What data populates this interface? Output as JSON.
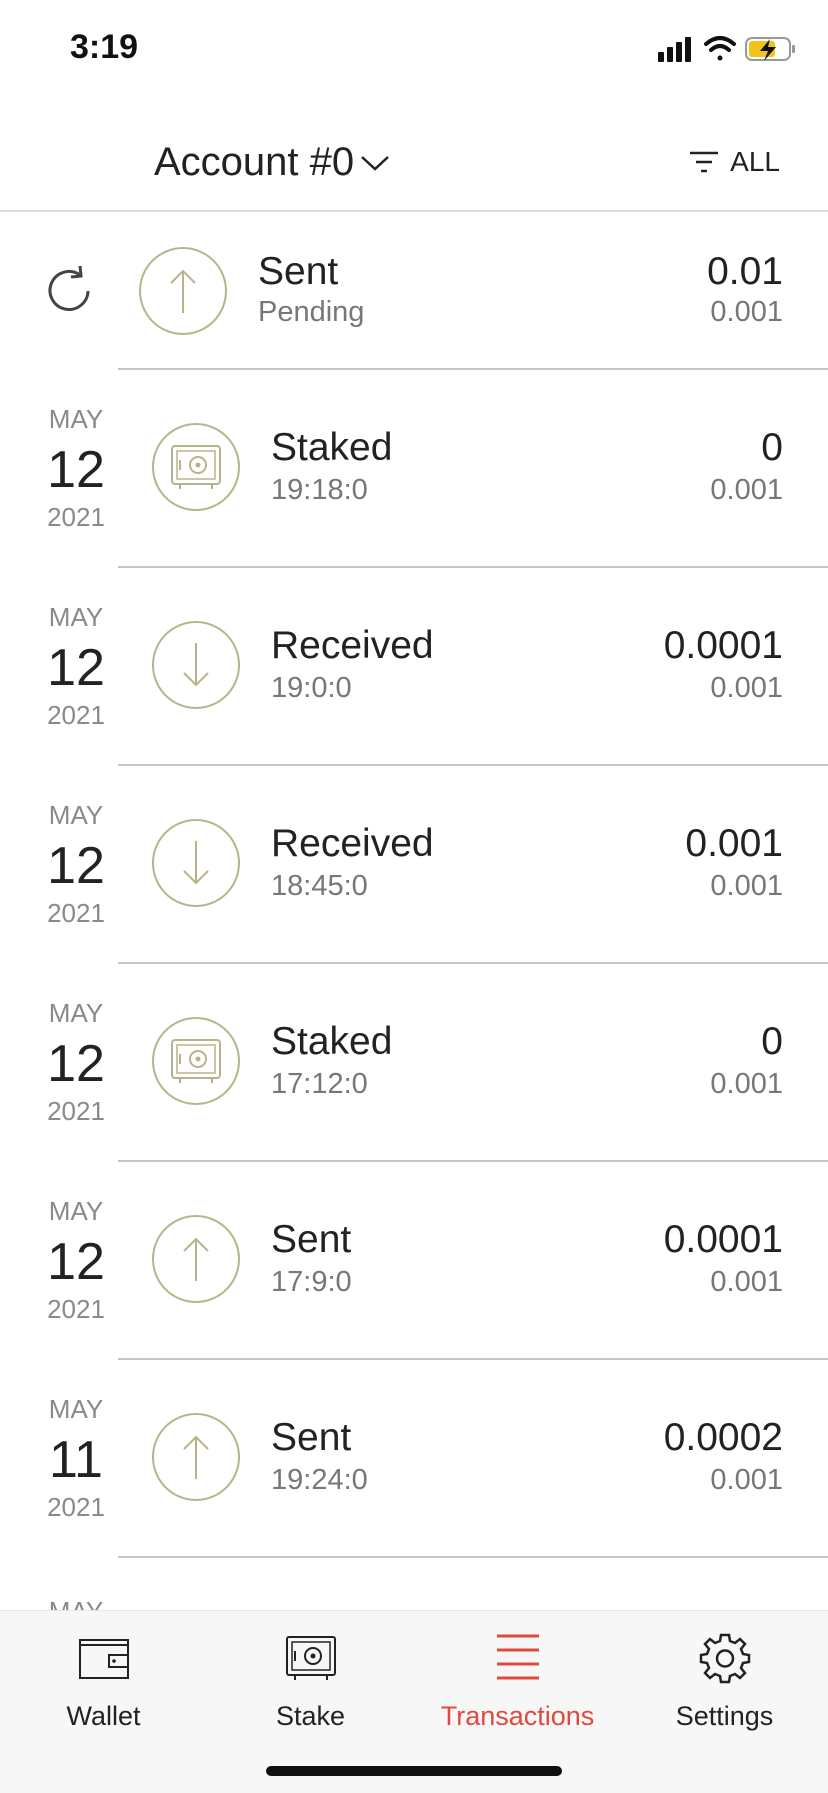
{
  "status_bar": {
    "time": "3:19"
  },
  "header": {
    "account_label": "Account #0",
    "filter_label": "ALL"
  },
  "pending": {
    "type": "Sent",
    "status": "Pending",
    "amount": "0.01",
    "fee": "0.001",
    "icon": "arrow-up-icon"
  },
  "transactions": [
    {
      "month": "MAY",
      "day": "12",
      "year": "2021",
      "type": "Staked",
      "time": "19:18:0",
      "amount": "0",
      "fee": "0.001",
      "icon": "safe-icon"
    },
    {
      "month": "MAY",
      "day": "12",
      "year": "2021",
      "type": "Received",
      "time": "19:0:0",
      "amount": "0.0001",
      "fee": "0.001",
      "icon": "arrow-down-icon"
    },
    {
      "month": "MAY",
      "day": "12",
      "year": "2021",
      "type": "Received",
      "time": "18:45:0",
      "amount": "0.001",
      "fee": "0.001",
      "icon": "arrow-down-icon"
    },
    {
      "month": "MAY",
      "day": "12",
      "year": "2021",
      "type": "Staked",
      "time": "17:12:0",
      "amount": "0",
      "fee": "0.001",
      "icon": "safe-icon"
    },
    {
      "month": "MAY",
      "day": "12",
      "year": "2021",
      "type": "Sent",
      "time": "17:9:0",
      "amount": "0.0001",
      "fee": "0.001",
      "icon": "arrow-up-icon"
    },
    {
      "month": "MAY",
      "day": "11",
      "year": "2021",
      "type": "Sent",
      "time": "19:24:0",
      "amount": "0.0002",
      "fee": "0.001",
      "icon": "arrow-up-icon"
    }
  ],
  "partial_next_month": "MAY",
  "tabs": [
    {
      "label": "Wallet",
      "icon": "wallet-icon",
      "active": false
    },
    {
      "label": "Stake",
      "icon": "safe-icon",
      "active": false
    },
    {
      "label": "Transactions",
      "icon": "list-icon",
      "active": true
    },
    {
      "label": "Settings",
      "icon": "gear-icon",
      "active": false
    }
  ],
  "colors": {
    "accent": "#e0493d",
    "icon_ring": "#b8b48a",
    "divider": "#c7c7c7"
  }
}
